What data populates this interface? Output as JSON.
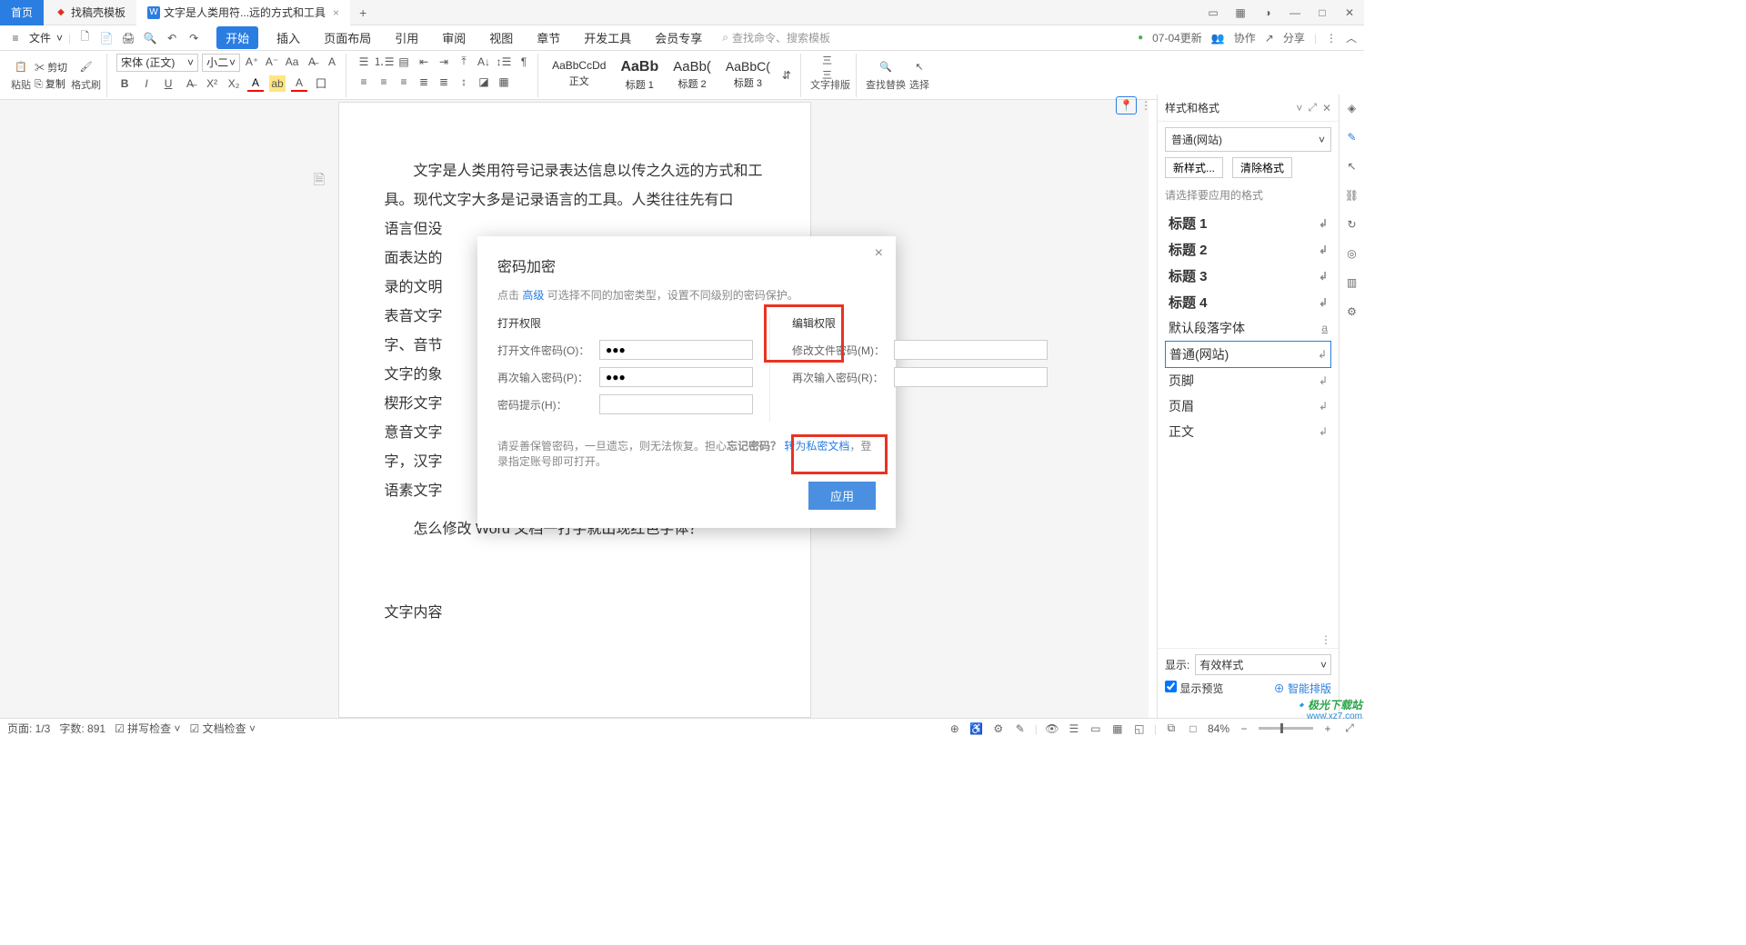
{
  "titlebar": {
    "home": "首页",
    "tab1": "找稿壳模板",
    "tab2": "文字是人类用符...远的方式和工具",
    "tab2_close": "×",
    "new_tab": "+",
    "win_icons": [
      "▭",
      "▦",
      "◑"
    ],
    "win_min": "—",
    "win_max": "□",
    "win_close": "✕"
  },
  "menubar": {
    "hamburger": "≡",
    "file": "文件",
    "file_arrow": "˅",
    "qa_icons": [
      "🗋",
      "📄",
      "🖨",
      "🔍",
      "↶",
      "↷"
    ],
    "tabs": [
      "开始",
      "插入",
      "页面布局",
      "引用",
      "审阅",
      "视图",
      "章节",
      "开发工具",
      "会员专享"
    ],
    "search_icon": "⌕",
    "search_placeholder": "查找命令、搜索模板",
    "cloud_text": "07-04更新",
    "collab": "协作",
    "share": "分享",
    "collab_icon": "👥",
    "share_icon": "↗",
    "chevron": "︿",
    "more": "⋮"
  },
  "ribbon": {
    "paste": "粘贴",
    "cut": "剪切",
    "copy": "复制",
    "format_painter": "格式刷",
    "font_name": "宋体 (正文)",
    "font_size": "小二",
    "body_text": "正文",
    "heading1": "标题 1",
    "heading2": "标题 2",
    "heading3": "标题 3",
    "style_preview1": "AaBbCcDd",
    "style_preview2": "AaBb",
    "style_preview3": "AaBb(",
    "style_preview4": "AaBbC(",
    "layout": "文字排版",
    "find": "查找替换",
    "select": "选择"
  },
  "document": {
    "para1": "文字是人类用符号记录表达信息以传之久远的方式和工具。现代文字大多是记录语言的工具。人类往往先有口",
    "para1b": "语言但没",
    "para1c": "面表达的",
    "para1d": "录的文明",
    "para1e": "表音文字",
    "para1f": "字、音节",
    "para1g": "文字的象",
    "para1h": "楔形文字",
    "para1i": "意音文字",
    "para1j": "字，汉字",
    "para1k": "语素文字",
    "para2": "怎么修改 Word 文档一打字就出现红色字体？",
    "para3": "文字内容"
  },
  "dialog": {
    "title": "密码加密",
    "tip_prefix": "点击 ",
    "tip_link": "高级",
    "tip_suffix": " 可选择不同的加密类型，设置不同级别的密码保护。",
    "open_section": "打开权限",
    "edit_section": "编辑权限",
    "open_pwd_label": "打开文件密码(O)：",
    "open_pwd_value": "●●●",
    "open_confirm_label": "再次输入密码(P)：",
    "open_confirm_value": "●●●",
    "hint_label": "密码提示(H)：",
    "edit_pwd_label": "修改文件密码(M)：",
    "edit_confirm_label": "再次输入密码(R)：",
    "note_prefix": "请妥善保管密码，一旦遗忘，则无法恢复。担心",
    "note_bold": "忘记密码？",
    "note_link": "转为私密文档",
    "note_suffix": "，登录指定账号即可打开。",
    "apply": "应用",
    "close": "×"
  },
  "loc_nav": {
    "pin": "📍",
    "dots": "⋮"
  },
  "right_panel": {
    "title": "样式和格式",
    "pin_icon": "⤢",
    "close_icon": "✕",
    "current_style": "普通(网站)",
    "btn_new": "新样式...",
    "btn_clear": "清除格式",
    "hint": "请选择要应用的格式",
    "items": [
      {
        "label": "标题 1",
        "bold": true
      },
      {
        "label": "标题 2",
        "bold": true
      },
      {
        "label": "标题 3",
        "bold": true
      },
      {
        "label": "标题 4",
        "bold": true
      },
      {
        "label": "默认段落字体",
        "bold": false,
        "underline": true
      },
      {
        "label": "普通(网站)",
        "bold": false,
        "selected": true
      },
      {
        "label": "页脚",
        "bold": false
      },
      {
        "label": "页眉",
        "bold": false
      },
      {
        "label": "正文",
        "bold": false
      }
    ],
    "show_label": "显示:",
    "show_value": "有效样式",
    "preview_checkbox": "显示预览",
    "smart_layout": "智能排版",
    "dots": "⋮"
  },
  "statusbar": {
    "page": "页面: 1/3",
    "words": "字数: 891",
    "spellcheck": "拼写检查",
    "doccheck": "文档检查",
    "zoom": "84%",
    "views": [
      "👁",
      "☰",
      "▭",
      "▦",
      "◱"
    ],
    "sb_icons_left": [
      "⊕",
      "♿",
      "⚙",
      "✎"
    ],
    "sb_icons_right": [
      "⧉",
      "□"
    ],
    "minus": "−",
    "plus": "+"
  },
  "watermark": {
    "main": "极光下载站",
    "sub": "www.xz7.com"
  }
}
